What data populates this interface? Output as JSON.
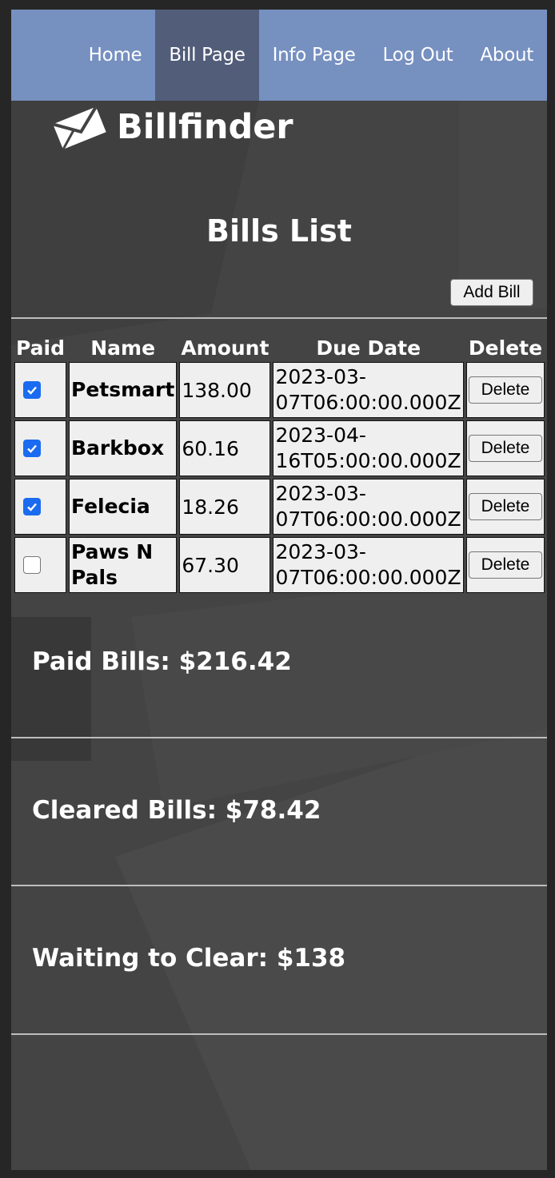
{
  "nav": {
    "items": [
      {
        "label": "Home",
        "active": false
      },
      {
        "label": "Bill Page",
        "active": true
      },
      {
        "label": "Info Page",
        "active": false
      },
      {
        "label": "Log Out",
        "active": false
      },
      {
        "label": "About",
        "active": false
      }
    ]
  },
  "brand": {
    "name": "Billfinder",
    "icon": "envelope-icon"
  },
  "page": {
    "title": "Bills List",
    "add_button": "Add Bill"
  },
  "table": {
    "headers": {
      "paid": "Paid",
      "name": "Name",
      "amount": "Amount",
      "due": "Due Date",
      "delete": "Delete"
    },
    "rows": [
      {
        "paid": true,
        "name": "Petsmart",
        "amount": "138.00",
        "due": "2023-03-07T06:00:00.000Z",
        "delete": "Delete"
      },
      {
        "paid": true,
        "name": "Barkbox",
        "amount": "60.16",
        "due": "2023-04-16T05:00:00.000Z",
        "delete": "Delete"
      },
      {
        "paid": true,
        "name": "Felecia",
        "amount": "18.26",
        "due": "2023-03-07T06:00:00.000Z",
        "delete": "Delete"
      },
      {
        "paid": false,
        "name": "Paws N Pals",
        "amount": "67.30",
        "due": "2023-03-07T06:00:00.000Z",
        "delete": "Delete"
      }
    ]
  },
  "summary": {
    "paid": "Paid Bills: $216.42",
    "cleared": "Cleared Bills: $78.42",
    "waiting": "Waiting to Clear: $138"
  },
  "colors": {
    "nav": "#7690c0",
    "nav_active": "#515d79",
    "background": "#434343",
    "checkbox": "#1a6bf0"
  }
}
